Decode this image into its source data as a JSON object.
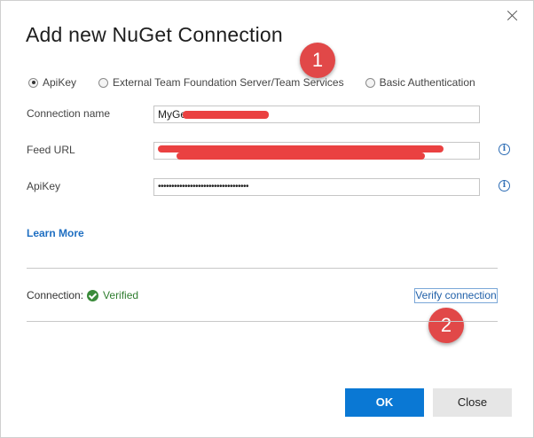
{
  "dialog": {
    "title": "Add new NuGet Connection"
  },
  "callouts": [
    "1",
    "2"
  ],
  "auth_options": [
    {
      "label": "ApiKey",
      "selected": true
    },
    {
      "label": "External Team Foundation Server/Team Services",
      "selected": false
    },
    {
      "label": "Basic Authentication",
      "selected": false
    }
  ],
  "fields": {
    "connection_name": {
      "label": "Connection name",
      "value": "MyGet"
    },
    "feed_url": {
      "label": "Feed URL",
      "value": ""
    },
    "apikey": {
      "label": "ApiKey",
      "value": "••••••••••••••••••••••••••••••••••"
    }
  },
  "learn_more": "Learn More",
  "connection": {
    "label": "Connection:",
    "status": "Verified",
    "verify_label": "Verify connection"
  },
  "buttons": {
    "ok": "OK",
    "close": "Close"
  },
  "colors": {
    "accent": "#0a78d4",
    "callout": "#e14848",
    "verified": "#3a8b3a",
    "redaction": "#ea4141"
  },
  "icons": {
    "close": "close-icon",
    "info": "info-icon",
    "check": "check-circle-icon"
  }
}
